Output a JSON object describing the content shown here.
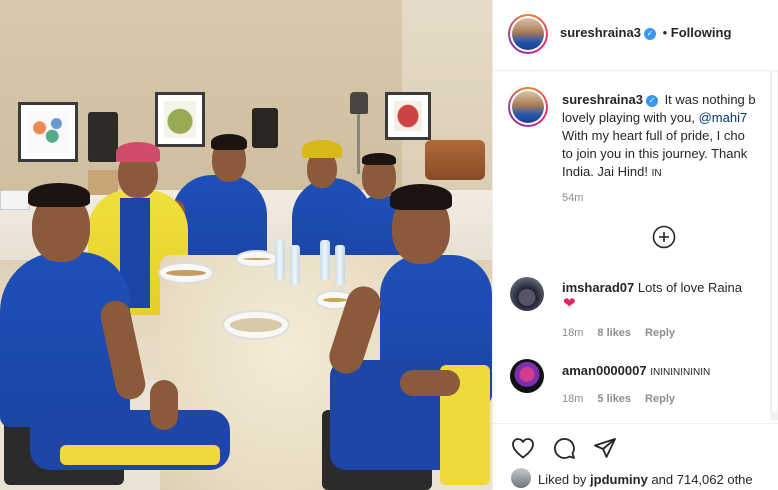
{
  "header": {
    "username": "sureshraina3",
    "separator": "•",
    "follow_status": "Following"
  },
  "caption": {
    "username": "sureshraina3",
    "line1": "It was nothing b",
    "line2_prefix": "lovely playing with you, ",
    "line2_mention": "@mahi7",
    "line3": "With my heart full of pride, I cho",
    "line4": "to join you in this journey. Thank",
    "line5_prefix": "India. Jai Hind! ",
    "line5_flag": "IN",
    "time": "54m"
  },
  "load_more": {
    "icon": "plus-circle-icon"
  },
  "comments": [
    {
      "username": "imsharad07",
      "text": "Lots of love Raina",
      "emoji": "❤",
      "time": "18m",
      "likes": "8 likes",
      "reply": "Reply"
    },
    {
      "username": "aman0000007",
      "text": "ININININININ",
      "time": "18m",
      "likes": "5 likes",
      "reply": "Reply"
    }
  ],
  "actions": {
    "like_icon": "heart-icon",
    "comment_icon": "comment-icon",
    "share_icon": "share-icon"
  },
  "likes": {
    "prefix": "Liked by ",
    "user": "jpduminy",
    "suffix": " and 714,062 othe"
  },
  "colors": {
    "accent_link": "#00376b",
    "verified": "#3897f0",
    "jersey_blue": "#1f4fb8",
    "jersey_yellow": "#f0df3a"
  }
}
